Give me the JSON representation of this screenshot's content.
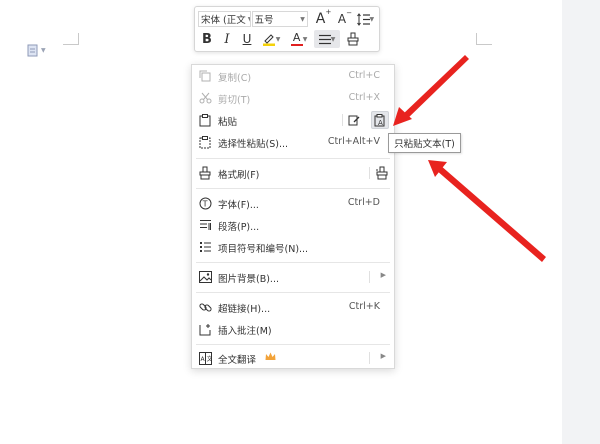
{
  "toolbar": {
    "font_name": "宋体 (正文",
    "font_size": "五号",
    "grow_font": "A",
    "shrink_font": "A",
    "bold": "B",
    "italic": "I",
    "underline": "U",
    "font_color": "A"
  },
  "menu": {
    "copy": {
      "label": "复制(C)",
      "shortcut": "Ctrl+C"
    },
    "cut": {
      "label": "剪切(T)",
      "shortcut": "Ctrl+X"
    },
    "paste": {
      "label": "粘贴"
    },
    "paste_special": {
      "label": "选择性粘贴(S)...",
      "shortcut": "Ctrl+Alt+V"
    },
    "format_painter": {
      "label": "格式刷(F)"
    },
    "font": {
      "label": "字体(F)...",
      "shortcut": "Ctrl+D"
    },
    "paragraph": {
      "label": "段落(P)..."
    },
    "bullets": {
      "label": "项目符号和编号(N)..."
    },
    "picture_background": {
      "label": "图片背景(B)..."
    },
    "hyperlink": {
      "label": "超链接(H)...",
      "shortcut": "Ctrl+K"
    },
    "insert_comment": {
      "label": "插入批注(M)"
    },
    "translate": {
      "label": "全文翻译"
    }
  },
  "tooltip": {
    "text": "只粘贴文本(T)"
  },
  "colors": {
    "highlight": "#f5d20a",
    "font_color_bar": "#e02020",
    "annotation_arrow": "#e8231f",
    "crown": "#f2a33a"
  }
}
